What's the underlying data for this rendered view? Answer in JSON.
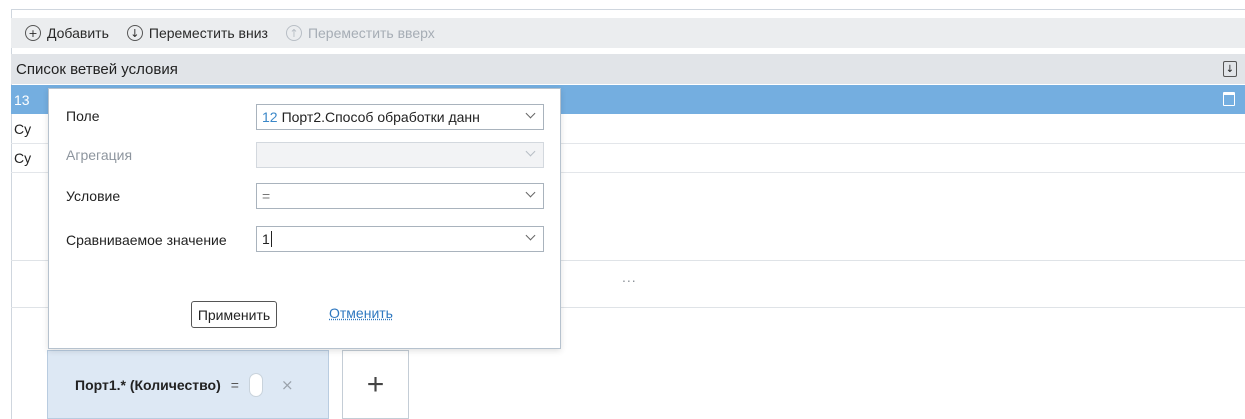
{
  "toolbar": {
    "add_label": "Добавить",
    "move_down_label": "Переместить вниз",
    "move_up_label": "Переместить вверх"
  },
  "list": {
    "header": "Список ветвей условия",
    "rows": [
      {
        "text": "13"
      },
      {
        "text": "Су"
      },
      {
        "text": "Су"
      }
    ]
  },
  "ellipsis": "...",
  "popup": {
    "field_label": "Поле",
    "field_number": "12",
    "field_value": "Порт2.Способ обработки данн",
    "aggregation_label": "Агрегация",
    "aggregation_value": "",
    "condition_label": "Условие",
    "condition_value": "=",
    "compare_label": "Сравниваемое значение",
    "compare_value": "1",
    "apply_label": "Применить",
    "cancel_label": "Отменить"
  },
  "chip": {
    "label": "Порт1.* (Количество)",
    "operator": "=",
    "remove_icon": "×"
  },
  "add_icon": "+"
}
